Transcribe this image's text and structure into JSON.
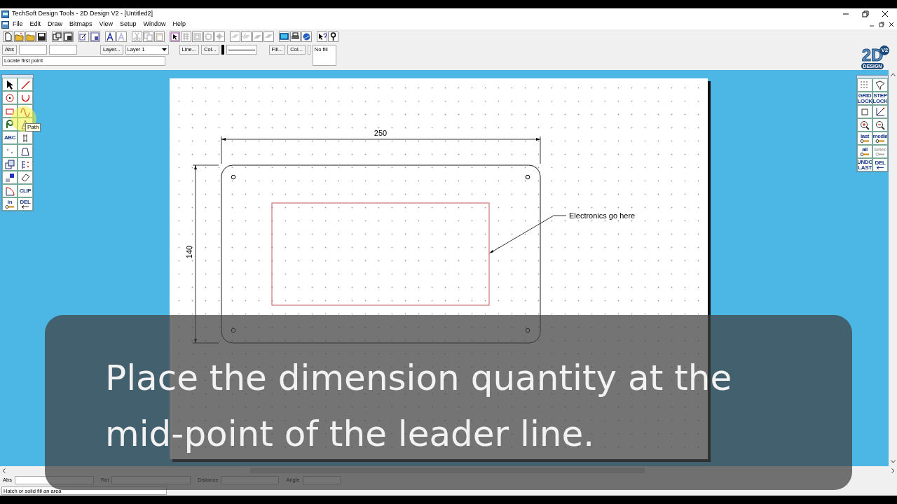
{
  "window": {
    "title": "TechSoft Design Tools - 2D Design V2 - [Untitled2]"
  },
  "menu": [
    "File",
    "Edit",
    "Draw",
    "Bitmaps",
    "View",
    "Setup",
    "Window",
    "Help"
  ],
  "toolbar": [
    {
      "disabled": false
    },
    {
      "disabled": false
    },
    {
      "disabled": false
    },
    {
      "disabled": false
    },
    {
      "disabled": false
    },
    {
      "disabled": false
    },
    {
      "disabled": false
    },
    {
      "disabled": false
    },
    {
      "disabled": false
    },
    {
      "disabled": true
    },
    {
      "disabled": true
    },
    {
      "disabled": true
    },
    {
      "disabled": true
    },
    {
      "disabled": false
    },
    {
      "disabled": true
    },
    {
      "disabled": true
    },
    {
      "disabled": true
    },
    {
      "disabled": true
    },
    {
      "disabled": true
    },
    {
      "disabled": true
    },
    {
      "disabled": true
    },
    {
      "disabled": true
    },
    {
      "disabled": false
    },
    {
      "disabled": false
    },
    {
      "disabled": false
    },
    {
      "disabled": false
    },
    {
      "disabled": false
    }
  ],
  "options_bar": {
    "abs_button": "Abs",
    "layer_button": "Layer...",
    "layer_select": "Layer 1",
    "line_button": "Line...",
    "line_color_button": "Col...",
    "fill_button": "Fill...",
    "fill_color_button": "Col...",
    "fill_value": "No fill",
    "prompt": "Locate first point"
  },
  "logo": {
    "mark": "2D",
    "word": "DESIGN",
    "version": "V2"
  },
  "left_tools": [
    {
      "kind": "icon"
    },
    {
      "kind": "icon"
    },
    {
      "kind": "icon"
    },
    {
      "kind": "icon"
    },
    {
      "kind": "icon"
    },
    {
      "kind": "icon"
    },
    {
      "kind": "icon"
    },
    {
      "kind": "icon"
    },
    {
      "kind": "text",
      "label": "ABC"
    },
    {
      "kind": "icon"
    },
    {
      "kind": "icon"
    },
    {
      "kind": "icon"
    },
    {
      "kind": "icon"
    },
    {
      "kind": "icon"
    },
    {
      "kind": "icon"
    },
    {
      "kind": "icon"
    },
    {
      "kind": "icon"
    },
    {
      "kind": "text",
      "label": "CLIP"
    },
    {
      "kind": "text",
      "label": "in"
    },
    {
      "kind": "text",
      "label": "DEL"
    }
  ],
  "cursor_tooltip": "Path",
  "right_tools": [
    {
      "kind": "icon",
      "disabled": false
    },
    {
      "kind": "icon",
      "disabled": false
    },
    {
      "kind": "text",
      "label": "GRID LOCK",
      "disabled": false
    },
    {
      "kind": "text",
      "label": "STEP LOCK",
      "disabled": false
    },
    {
      "kind": "icon",
      "disabled": false
    },
    {
      "kind": "icon",
      "disabled": false
    },
    {
      "kind": "icon",
      "disabled": false
    },
    {
      "kind": "icon",
      "disabled": false
    },
    {
      "kind": "text",
      "label": "last",
      "disabled": false
    },
    {
      "kind": "text",
      "label": "media",
      "disabled": false
    },
    {
      "kind": "text",
      "label": "all",
      "disabled": false
    },
    {
      "kind": "text",
      "label": "selec",
      "disabled": true
    },
    {
      "kind": "text",
      "label": "UNDO LAST",
      "disabled": false
    },
    {
      "kind": "text",
      "label": "DEL",
      "disabled": false
    }
  ],
  "drawing": {
    "width_dimension": "250",
    "height_dimension": "140",
    "note": "Electronics go here"
  },
  "coordinates": [
    {
      "label": "Abs"
    },
    {
      "label": "Rel"
    },
    {
      "label": "Distance"
    },
    {
      "label": "Angle"
    }
  ],
  "hint": "Hatch or solid fill an area",
  "caption": "Place the dimension quantity at the mid-point of the leader line."
}
